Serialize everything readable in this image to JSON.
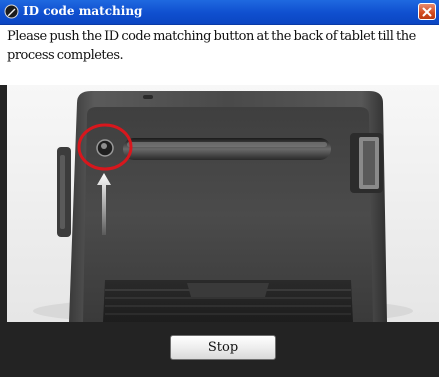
{
  "window": {
    "title": "ID code matching",
    "title_icon": "tablet-pen-icon",
    "close_icon": "close-icon"
  },
  "message": {
    "text": "Please push the ID code matching button at the back of tablet till the process completes."
  },
  "illustration": {
    "subject": "tablet-back-with-pairing-button",
    "highlight_color": "#d8171d"
  },
  "footer": {
    "stop_label": "Stop"
  },
  "colors": {
    "titlebar": "#0f4fcf",
    "close_button": "#d24a1f",
    "footer_background": "#232323",
    "highlight": "#d8171d"
  }
}
